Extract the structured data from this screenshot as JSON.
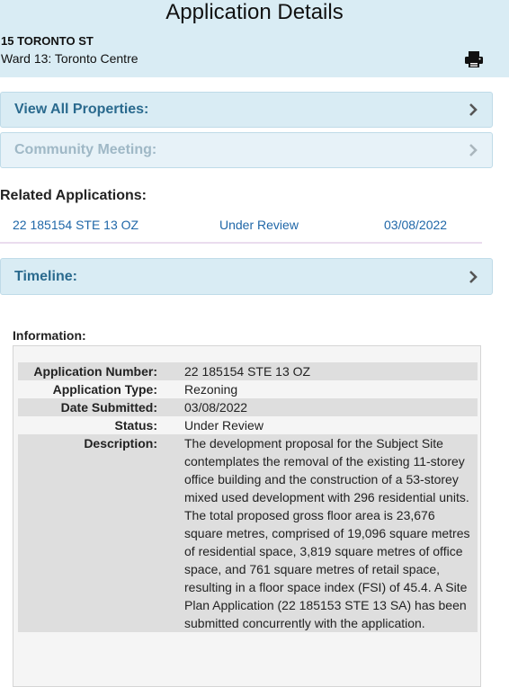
{
  "header": {
    "title": "Application Details",
    "address": "15 TORONTO ST",
    "ward": "Ward 13: Toronto Centre",
    "print_icon": "printer-icon"
  },
  "sections": {
    "view_all_properties": "View All Properties:",
    "community_meeting": "Community Meeting:",
    "timeline": "Timeline:"
  },
  "related": {
    "heading": "Related Applications:",
    "items": [
      {
        "number": "22 185154 STE 13 OZ",
        "status": "Under Review",
        "date": "03/08/2022"
      }
    ]
  },
  "information": {
    "heading": "Information:",
    "rows": [
      {
        "key": "Application Number:",
        "value": "22 185154 STE 13 OZ"
      },
      {
        "key": "Application Type:",
        "value": "Rezoning"
      },
      {
        "key": "Date Submitted:",
        "value": "03/08/2022"
      },
      {
        "key": "Status:",
        "value": "Under Review"
      },
      {
        "key": "Description:",
        "value": "The development proposal for the Subject Site contemplates the removal of the existing 11-storey office building and the construction of a 53-storey mixed used development with 296 residential units. The total proposed gross floor area is 23,676 square metres, comprised of 19,096 square metres of residential space, 3,819 square metres of office space, and 761 square metres of retail space, resulting in a floor space index (FSI) of 45.4. A Site Plan Application (22 185153 STE 13 SA) has been submitted concurrently with the application."
      }
    ]
  },
  "colors": {
    "header_bg": "#d9ecf4",
    "accent_text": "#2a6a8e",
    "link": "#1f67a8"
  }
}
